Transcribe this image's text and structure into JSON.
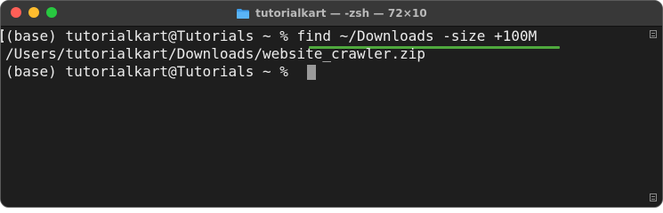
{
  "window": {
    "title": "tutorialkart — -zsh — 72×10",
    "folder_icon": "folder-icon",
    "traffic_lights": {
      "close": "#fe5f57",
      "minimize": "#febc2e",
      "zoom": "#28c840"
    }
  },
  "terminal": {
    "lines": [
      "(base) tutorialkart@Tutorials ~ % find ~/Downloads -size +100M",
      "/Users/tutorialkart/Downloads/website_crawler.zip",
      "(base) tutorialkart@Tutorials ~ % "
    ],
    "highlight_color": "#4fa83d",
    "background_color": "#1e1e1e",
    "text_color": "#ececec"
  }
}
